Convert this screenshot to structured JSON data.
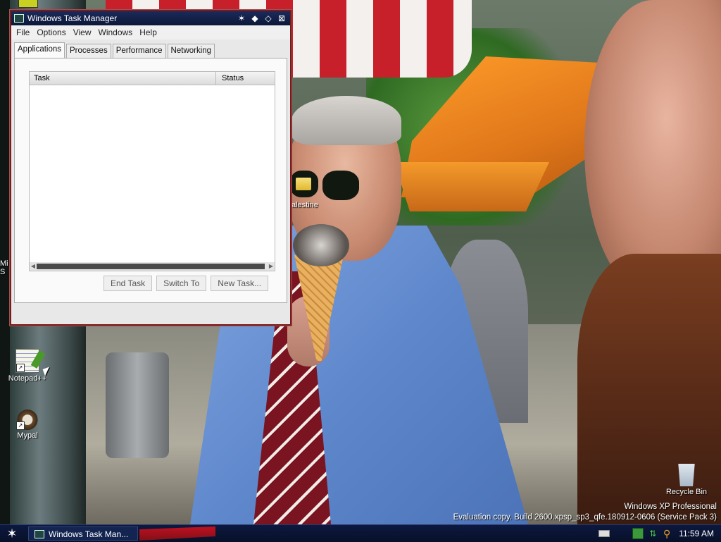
{
  "window": {
    "title": "Windows Task Manager",
    "menu": [
      "File",
      "Options",
      "View",
      "Windows",
      "Help"
    ],
    "tabs": [
      "Applications",
      "Processes",
      "Performance",
      "Networking"
    ],
    "active_tab": "Applications",
    "columns": [
      "Task",
      "Status"
    ],
    "rows": [],
    "buttons": {
      "end_task": "End Task",
      "switch_to": "Switch To",
      "new_task": "New Task..."
    }
  },
  "desktop": {
    "icons": [
      {
        "label": "Notepad++",
        "icon": "notepad-icon"
      },
      {
        "label": "Mypal",
        "icon": "raccoon-icon"
      },
      {
        "label": "Recycle Bin",
        "icon": "recycle-bin-icon"
      }
    ],
    "clipped_label": "Mi\nS",
    "folder_label": "alestine"
  },
  "watermark": {
    "line1": "Windows XP Professional",
    "line2": "Evaluation copy. Build 2600.xpsp_sp3_qfe.180912-0606 (Service Pack 3)"
  },
  "taskbar": {
    "task_button": "Windows Task Man...",
    "clock": "11:59 AM"
  },
  "colors": {
    "titlebar": "#0c1838",
    "window_border": "#7a1a1a",
    "taskbar": "#081028"
  }
}
